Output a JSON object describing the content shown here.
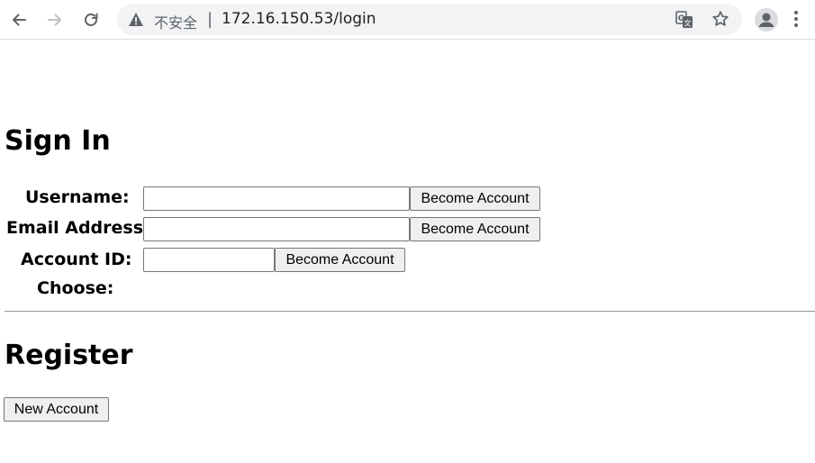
{
  "browser": {
    "security_label": "不安全",
    "separator": "|",
    "url": "172.16.150.53/login"
  },
  "signin": {
    "title": "Sign In",
    "username_label": "Username:",
    "username_value": "",
    "username_button": "Become Account",
    "email_label": "Email Address:",
    "email_value": "",
    "email_button": "Become Account",
    "account_id_label": "Account ID:",
    "account_id_value": "",
    "account_id_button": "Become Account",
    "choose_label": "Choose:"
  },
  "register": {
    "title": "Register",
    "new_account_button": "New Account"
  },
  "icons": {
    "back": "back-arrow-icon",
    "forward": "forward-arrow-icon",
    "reload": "reload-icon",
    "warning": "warning-icon",
    "translate": "translate-icon",
    "bookmark": "star-icon",
    "profile": "profile-icon",
    "menu": "more-vert-icon"
  }
}
